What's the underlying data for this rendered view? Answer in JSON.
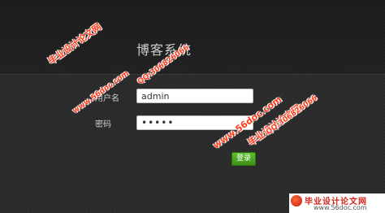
{
  "header": {
    "title": "博客系统"
  },
  "login_form": {
    "username_label": "用户名",
    "username_value": "admin",
    "password_label": "密码",
    "password_value": "•••••",
    "login_button": "登录"
  },
  "watermark": {
    "site_name": "毕业设计论文网",
    "url": "www.56doc.com",
    "qq": "QQ:306826066"
  },
  "colors": {
    "accent_button": "#4aa51f",
    "watermark": "#ff3c1a",
    "background": "#2e2e2e"
  }
}
